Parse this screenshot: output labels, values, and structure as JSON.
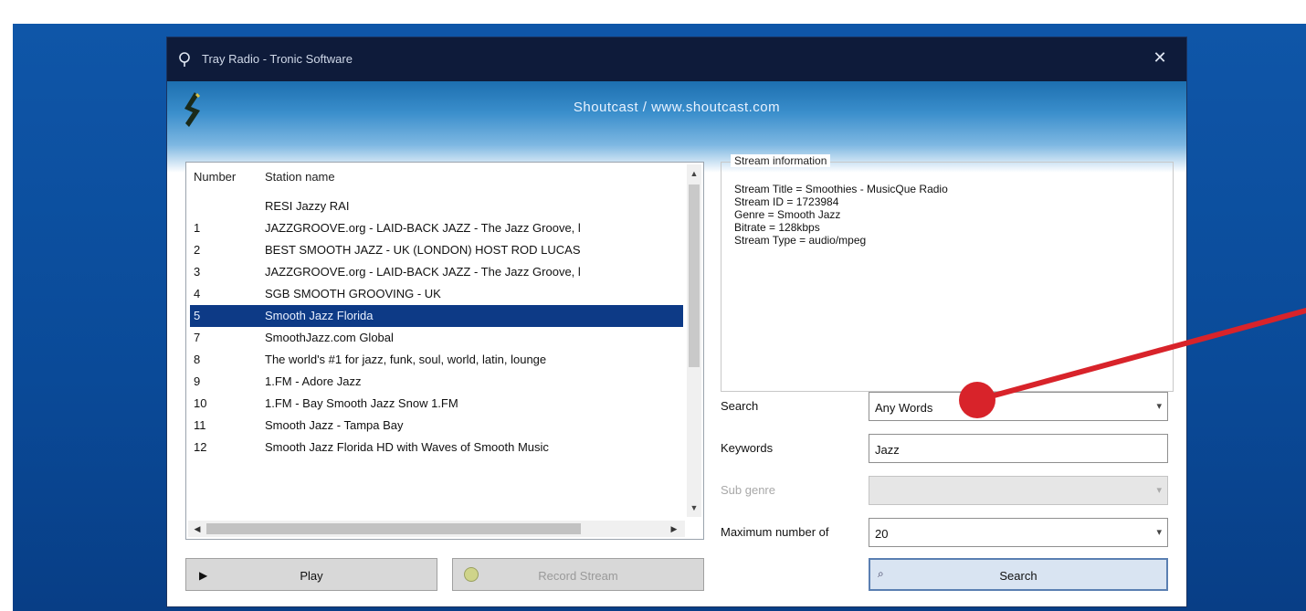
{
  "window": {
    "title": "Tray Radio - Tronic Software",
    "banner_text": "Shoutcast / www.shoutcast.com"
  },
  "stations": {
    "column_number": "Number",
    "column_name": "Station name",
    "rows": [
      {
        "num": "",
        "name": "RESI Jazzy RAI"
      },
      {
        "num": "1",
        "name": "JAZZGROOVE.org - LAID-BACK JAZZ - The Jazz Groove, l"
      },
      {
        "num": "2",
        "name": "BEST SMOOTH JAZZ - UK (LONDON) HOST ROD LUCAS"
      },
      {
        "num": "3",
        "name": "JAZZGROOVE.org - LAID-BACK JAZZ - The Jazz Groove, l"
      },
      {
        "num": "4",
        "name": "SGB SMOOTH GROOVING - UK"
      },
      {
        "num": "5",
        "name": "Smooth Jazz Florida"
      },
      {
        "num": "7",
        "name": "SmoothJazz.com Global"
      },
      {
        "num": "8",
        "name": "The world's #1 for jazz, funk, soul, world, latin, lounge"
      },
      {
        "num": "9",
        "name": "1.FM - Adore Jazz"
      },
      {
        "num": "10",
        "name": "1.FM - Bay Smooth Jazz Snow 1.FM"
      },
      {
        "num": "11",
        "name": "Smooth Jazz - Tampa Bay"
      },
      {
        "num": "12",
        "name": "Smooth Jazz Florida HD with Waves of Smooth Music"
      }
    ],
    "selected_index": 5
  },
  "buttons": {
    "play": "Play",
    "record": "Record Stream",
    "search": "Search"
  },
  "stream_info": {
    "legend": "Stream information",
    "lines": [
      "Stream Title = Smoothies - MusicQue Radio",
      "Stream ID = 1723984",
      "Genre = Smooth Jazz",
      "Bitrate = 128kbps",
      "Stream Type = audio/mpeg"
    ]
  },
  "search": {
    "search_label": "Search",
    "search_value": "Any Words",
    "keywords_label": "Keywords",
    "keywords_value": "Jazz",
    "genre_label": "Sub genre",
    "genre_value": "",
    "max_label": "Maximum number of",
    "max_value": "20"
  },
  "colors": {
    "selection": "#0d3a86",
    "annotation": "#d8232a"
  }
}
